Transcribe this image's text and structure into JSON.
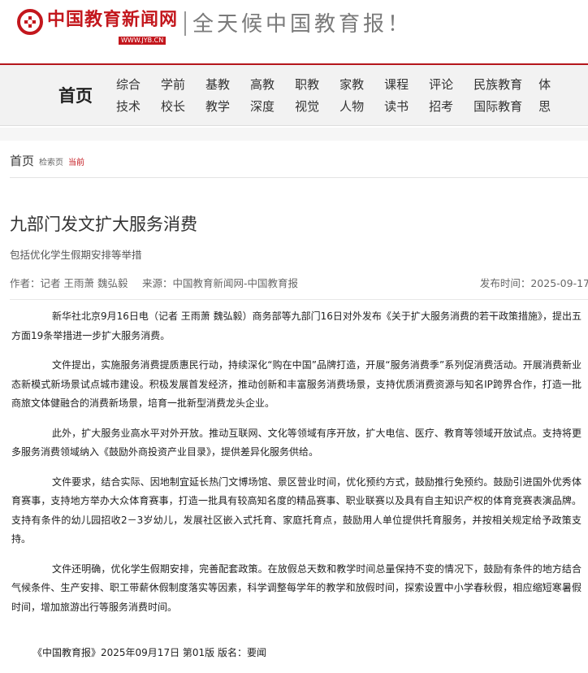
{
  "header": {
    "logo_text": "中国教育新闻网",
    "logo_url": "WWW.JYB.CN",
    "slogan": "全天候中国教育报！"
  },
  "nav": {
    "home": "首页",
    "row1": [
      "综合",
      "学前",
      "基教",
      "高教",
      "职教",
      "家教",
      "课程",
      "评论",
      "民族教育",
      "体"
    ],
    "row2": [
      "技术",
      "校长",
      "教学",
      "深度",
      "视觉",
      "人物",
      "读书",
      "招考",
      "国际教育",
      "思"
    ]
  },
  "breadcrumb": {
    "home": "首页",
    "search": "检索页",
    "current": "当前"
  },
  "article": {
    "title": "九部门发文扩大服务消费",
    "subtitle": "包括优化学生假期安排等举措",
    "author": "作者：记者 王雨萧 魏弘毅",
    "source": "来源：中国教育新闻网-中国教育报",
    "date": "发布时间：2025-09-17",
    "paragraphs": [
      "新华社北京9月16日电（记者 王雨萧 魏弘毅）商务部等九部门16日对外发布《关于扩大服务消费的若干政策措施》，提出五方面19条举措进一步扩大服务消费。",
      "文件提出，实施服务消费提质惠民行动，持续深化“购在中国”品牌打造，开展“服务消费季”系列促消费活动。开展消费新业态新模式新场景试点城市建设。积极发展首发经济，推动创新和丰富服务消费场景，支持优质消费资源与知名IP跨界合作，打造一批商旅文体健融合的消费新场景，培育一批新型消费龙头企业。",
      "此外，扩大服务业高水平对外开放。推动互联网、文化等领域有序开放，扩大电信、医疗、教育等领域开放试点。支持将更多服务消费领域纳入《鼓励外商投资产业目录》，提供差异化服务供给。",
      "文件要求，结合实际、因地制宜延长热门文博场馆、景区营业时间，优化预约方式，鼓励推行免预约。鼓励引进国外优秀体育赛事，支持地方举办大众体育赛事，打造一批具有较高知名度的精品赛事、职业联赛以及具有自主知识产权的体育竞赛表演品牌。支持有条件的幼儿园招收2－3岁幼儿，发展社区嵌入式托育、家庭托育点，鼓励用人单位提供托育服务，并按相关规定给予政策支持。",
      "文件还明确，优化学生假期安排，完善配套政策。在放假总天数和教学时间总量保持不变的情况下，鼓励有条件的地方结合气候条件、生产安排、职工带薪休假制度落实等因素，科学调整每学年的教学和放假时间，探索设置中小学春秋假，相应缩短寒暑假时间，增加旅游出行等服务消费时间。"
    ],
    "footer_source": "《中国教育报》2025年09月17日 第01版 版名：要闻"
  },
  "colors": {
    "brand_red": "#c3171d"
  }
}
